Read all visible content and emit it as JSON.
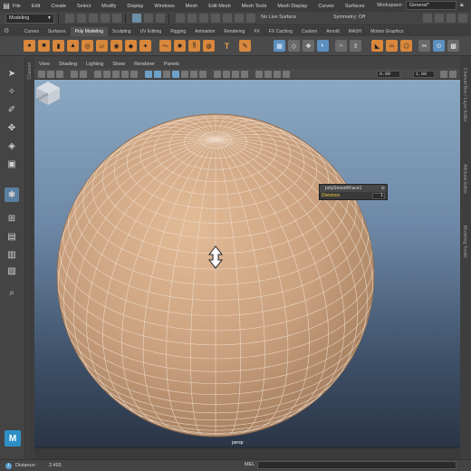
{
  "menubar": {
    "items": [
      "File",
      "Edit",
      "Create",
      "Select",
      "Modify",
      "Display",
      "Windows",
      "Mesh",
      "Edit Mesh",
      "Mesh Tools",
      "Mesh Display",
      "Curves",
      "Surfaces"
    ],
    "workspace_label": "Workspace:",
    "workspace_value": "General*"
  },
  "statusline": {
    "menuset": "Modeling",
    "live_surface": "No Live Surface",
    "symmetry": "Symmetry: Off"
  },
  "shelf": {
    "tabs": [
      "Curves",
      "Surfaces",
      "Poly Modeling",
      "Sculpting",
      "UV Editing",
      "Rigging",
      "Animation",
      "Rendering",
      "FX",
      "FX Caching",
      "Custom",
      "Arnold",
      "MASH",
      "Motion Graphics"
    ],
    "active_tab": "Poly Modeling"
  },
  "viewport": {
    "menus": [
      "View",
      "Shading",
      "Lighting",
      "Show",
      "Renderer",
      "Panels"
    ],
    "field_1": "0.00",
    "field_2": "1.00",
    "camera_label": "persp",
    "viewcube_label": "FRONT",
    "in_view_editor": {
      "node": "polySmoothFace1",
      "attribute": "Divisions",
      "value": "1"
    }
  },
  "left_strip_label": "Channel",
  "right_panels": [
    "Channel Box / Layer Editor",
    "Attribute Editor",
    "Modeling Toolkit"
  ],
  "helpline": {
    "text": "Distance:",
    "value": "2.493",
    "command_label": "MEL"
  },
  "colors": {
    "sphere_fill": "#c9a07d",
    "wireframe": "#f2e2d2",
    "active_tool": "#5a7fa0",
    "maya_logo": "#2e8fc6"
  }
}
